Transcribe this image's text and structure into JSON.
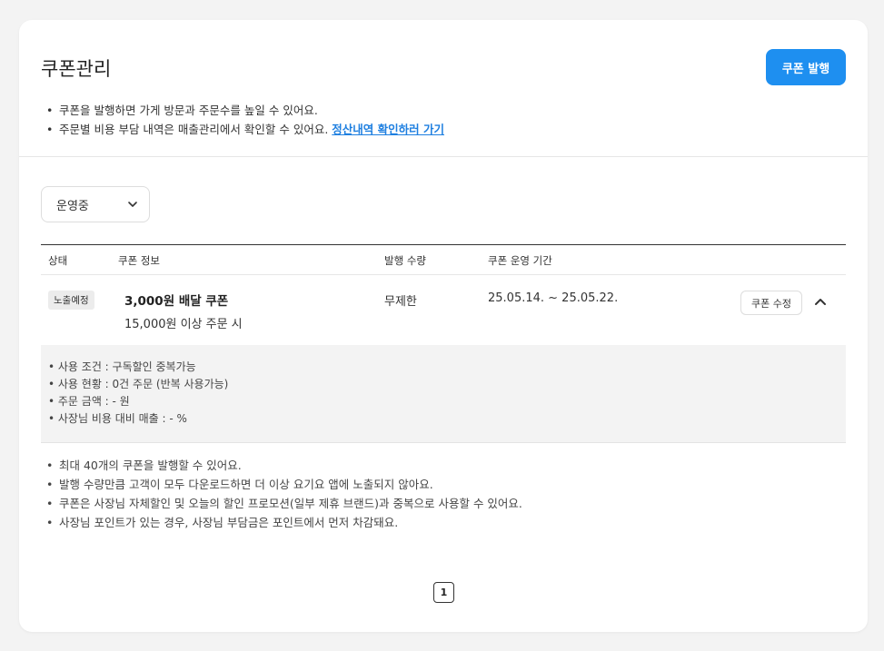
{
  "header": {
    "title": "쿠폰관리",
    "issue_button": "쿠폰 발행"
  },
  "top_notes": {
    "line1": "쿠폰을 발행하면 가게 방문과 주문수를 높일 수 있어요.",
    "line2": "주문별 비용 부담 내역은 매출관리에서 확인할 수 있어요.",
    "settle_link": "정산내역 확인하러 가기"
  },
  "filter": {
    "status_selected": "운영중"
  },
  "table": {
    "headers": {
      "status": "상태",
      "info": "쿠폰 정보",
      "qty": "발행 수량",
      "period": "쿠폰 운영 기간"
    },
    "row": {
      "status": "노출예정",
      "name": "3,000원 배달 쿠폰",
      "condition": "15,000원 이상 주문 시",
      "qty": "무제한",
      "period": "25.05.14. ~ 25.05.22.",
      "edit_button": "쿠폰 수정"
    },
    "details": [
      "• 사용 조건 : 구독할인 중복가능",
      "• 사용 현황 : 0건 주문 (반복 사용가능)",
      "• 주문 금액 : - 원",
      "• 사장님 비용 대비 매출 : - %"
    ]
  },
  "bottom_notes": [
    "최대 40개의 쿠폰을 발행할 수 있어요.",
    "발행 수량만큼 고객이 모두 다운로드하면 더 이상 요기요 앱에 노출되지 않아요.",
    "쿠폰은 사장님 자체할인 및 오늘의 할인 프로모션(일부 제휴 브랜드)과 중복으로 사용할 수 있어요.",
    "사장님 포인트가 있는 경우, 사장님 부담금은 포인트에서 먼저 차감돼요."
  ],
  "pagination": {
    "current_page": "1"
  },
  "colors": {
    "accent": "#1e8ff0",
    "link": "#1e7fe0"
  }
}
